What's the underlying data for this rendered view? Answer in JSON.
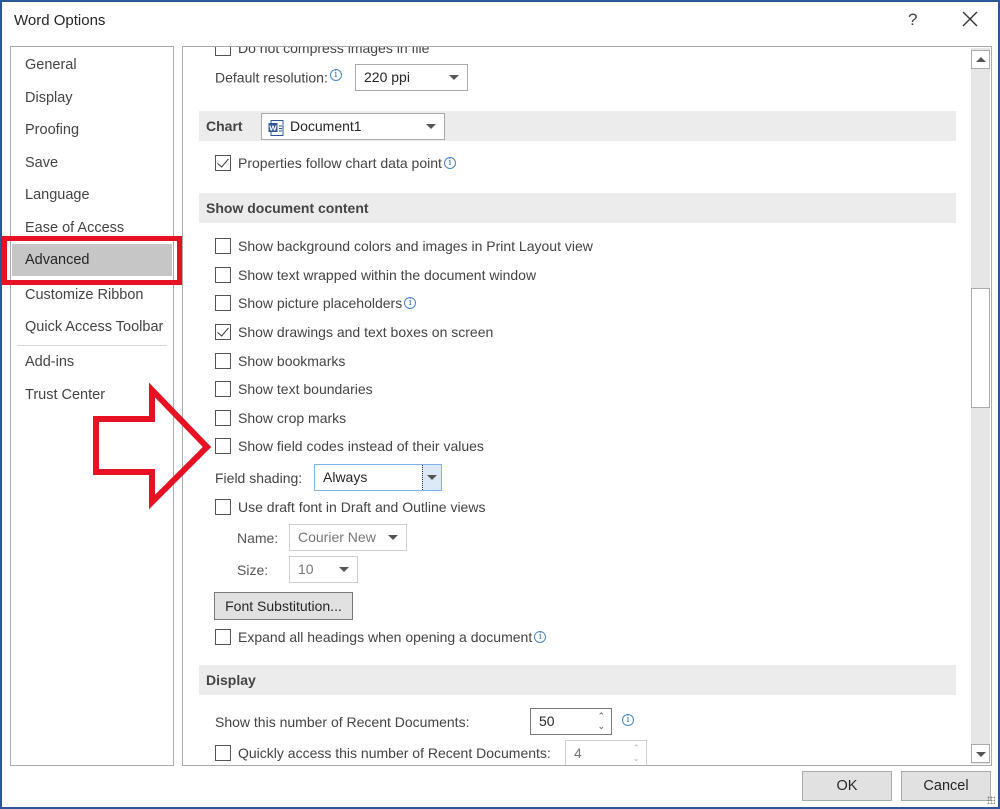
{
  "window": {
    "title": "Word Options",
    "help_label": "?",
    "close_label": "Close"
  },
  "sidebar": {
    "items": [
      {
        "label": "General"
      },
      {
        "label": "Display"
      },
      {
        "label": "Proofing"
      },
      {
        "label": "Save"
      },
      {
        "label": "Language"
      },
      {
        "label": "Ease of Access"
      },
      {
        "label": "Advanced",
        "active": true
      },
      {
        "label": "Customize Ribbon"
      },
      {
        "label": "Quick Access Toolbar"
      },
      {
        "label": "Add-ins"
      },
      {
        "label": "Trust Center"
      }
    ]
  },
  "content": {
    "partial_top_option": {
      "label": "Do not compress images in file",
      "checked": false
    },
    "default_resolution": {
      "label": "Default resolution:",
      "value": "220 ppi"
    },
    "chart": {
      "header": "Chart",
      "document_select": "Document1",
      "properties_follow": {
        "label": "Properties follow chart data point",
        "checked": true
      }
    },
    "show_document_content": {
      "header": "Show document content",
      "options": [
        {
          "label": "Show background colors and images in Print Layout view",
          "checked": false
        },
        {
          "label": "Show text wrapped within the document window",
          "checked": false
        },
        {
          "label": "Show picture placeholders",
          "checked": false,
          "info": true
        },
        {
          "label": "Show drawings and text boxes on screen",
          "checked": true
        },
        {
          "label": "Show bookmarks",
          "checked": false
        },
        {
          "label": "Show text boundaries",
          "checked": false
        },
        {
          "label": "Show crop marks",
          "checked": false
        },
        {
          "label": "Show field codes instead of their values",
          "checked": false
        }
      ],
      "field_shading": {
        "label": "Field shading:",
        "value": "Always"
      },
      "draft_font": {
        "label": "Use draft font in Draft and Outline views",
        "checked": false
      },
      "name": {
        "label": "Name:",
        "value": "Courier New"
      },
      "size": {
        "label": "Size:",
        "value": "10"
      },
      "font_substitution_button": "Font Substitution...",
      "expand_headings": {
        "label": "Expand all headings when opening a document",
        "checked": false
      }
    },
    "display": {
      "header": "Display",
      "recent_docs": {
        "label": "Show this number of Recent Documents:",
        "value": "50"
      },
      "quick_access": {
        "label": "Quickly access this number of Recent Documents:",
        "value": "4",
        "checked": false
      }
    }
  },
  "footer": {
    "ok_label": "OK",
    "cancel_label": "Cancel"
  },
  "annotations": {
    "highlight_color": "#e81123",
    "arrow_color": "#e81123"
  }
}
